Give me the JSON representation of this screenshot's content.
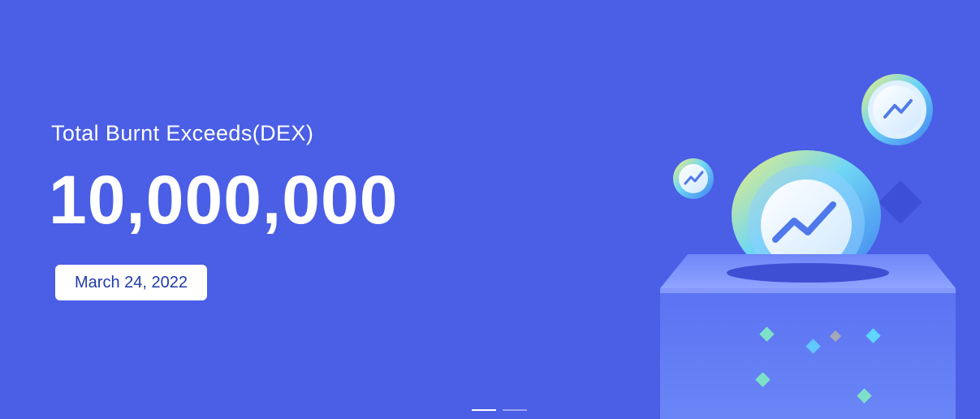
{
  "banner": {
    "subtitle": "Total Burnt Exceeds(DEX)",
    "amount": "10,000,000",
    "date": "March 24, 2022"
  },
  "pagination": {
    "count": 2,
    "active_index": 0
  },
  "colors": {
    "background": "#4a5ee6",
    "badge_text": "#1f3aa8",
    "accent_cyan": "#4fd3f0",
    "accent_yellow": "#e8e87a"
  },
  "illustration": {
    "icons": [
      "coin-icon",
      "trend-arrow-icon",
      "burn-box-icon",
      "diamond-icon"
    ]
  }
}
